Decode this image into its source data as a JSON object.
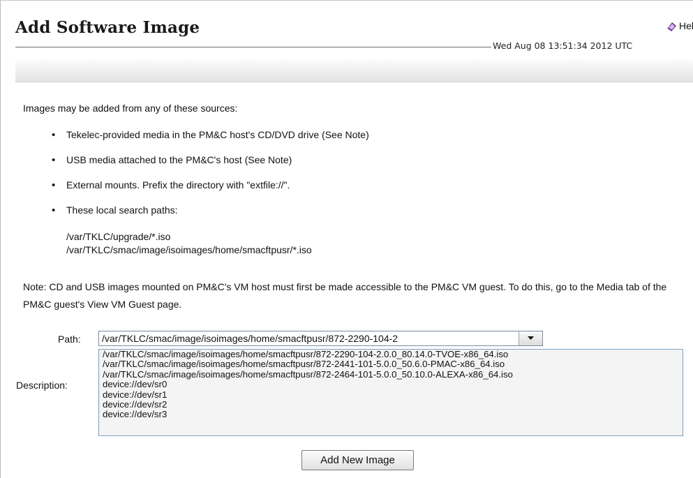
{
  "header": {
    "title": "Add Software Image",
    "help_label": "Help",
    "timestamp": "Wed Aug 08 13:51:34 2012 UTC"
  },
  "content": {
    "intro": "Images may be added from any of these sources:",
    "bullets": [
      "Tekelec-provided media in the PM&C host's CD/DVD drive (See Note)",
      "USB media attached to the PM&C's host (See Note)",
      "External mounts. Prefix the directory with \"extfile://\".",
      "These local search paths:"
    ],
    "search_paths": [
      "/var/TKLC/upgrade/*.iso",
      "/var/TKLC/smac/image/isoimages/home/smacftpusr/*.iso"
    ],
    "note": "Note: CD and USB images mounted on PM&C's VM host must first be made accessible to the PM&C VM guest. To do this, go to the Media tab of the PM&C guest's View VM Guest page."
  },
  "form": {
    "path_label": "Path:",
    "path_value": "/var/TKLC/smac/image/isoimages/home/smacftpusr/872-2290-104-2",
    "description_label": "Description:",
    "options": [
      "/var/TKLC/smac/image/isoimages/home/smacftpusr/872-2290-104-2.0.0_80.14.0-TVOE-x86_64.iso",
      "/var/TKLC/smac/image/isoimages/home/smacftpusr/872-2441-101-5.0.0_50.6.0-PMAC-x86_64.iso",
      "/var/TKLC/smac/image/isoimages/home/smacftpusr/872-2464-101-5.0.0_50.10.0-ALEXA-x86_64.iso",
      "device://dev/sr0",
      "device://dev/sr1",
      "device://dev/sr2",
      "device://dev/sr3"
    ],
    "submit_label": "Add New Image"
  },
  "icons": {
    "help": "help-book-icon",
    "dropdown": "chevron-down-icon"
  },
  "colors": {
    "toolbar_gradient_top": "#fbfbfb",
    "toolbar_gradient_bottom": "#e3e3e3",
    "listbox_border": "#7aa0c4"
  }
}
